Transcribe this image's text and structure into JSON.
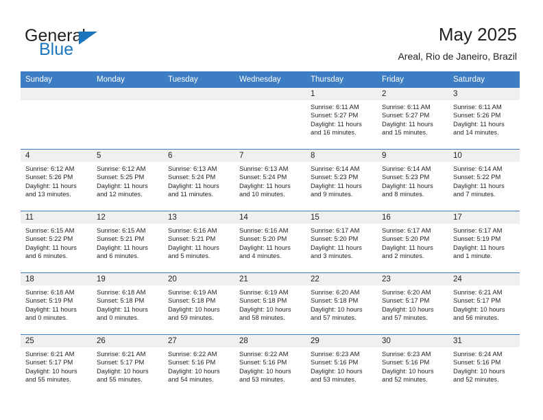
{
  "brand": {
    "name_part1": "General",
    "name_part2": "Blue",
    "triangle_color": "#1b75bc"
  },
  "header": {
    "title": "May 2025",
    "subtitle": "Areal, Rio de Janeiro, Brazil"
  },
  "theme": {
    "header_blue": "#3c7dc4",
    "daynum_gray": "#f0f0f0",
    "text": "#231f20"
  },
  "weekdays": [
    "Sunday",
    "Monday",
    "Tuesday",
    "Wednesday",
    "Thursday",
    "Friday",
    "Saturday"
  ],
  "weeks": [
    [
      {
        "day": "",
        "sunrise": "",
        "sunset": "",
        "daylight1": "",
        "daylight2": ""
      },
      {
        "day": "",
        "sunrise": "",
        "sunset": "",
        "daylight1": "",
        "daylight2": ""
      },
      {
        "day": "",
        "sunrise": "",
        "sunset": "",
        "daylight1": "",
        "daylight2": ""
      },
      {
        "day": "",
        "sunrise": "",
        "sunset": "",
        "daylight1": "",
        "daylight2": ""
      },
      {
        "day": "1",
        "sunrise": "Sunrise: 6:11 AM",
        "sunset": "Sunset: 5:27 PM",
        "daylight1": "Daylight: 11 hours",
        "daylight2": "and 16 minutes."
      },
      {
        "day": "2",
        "sunrise": "Sunrise: 6:11 AM",
        "sunset": "Sunset: 5:27 PM",
        "daylight1": "Daylight: 11 hours",
        "daylight2": "and 15 minutes."
      },
      {
        "day": "3",
        "sunrise": "Sunrise: 6:11 AM",
        "sunset": "Sunset: 5:26 PM",
        "daylight1": "Daylight: 11 hours",
        "daylight2": "and 14 minutes."
      }
    ],
    [
      {
        "day": "4",
        "sunrise": "Sunrise: 6:12 AM",
        "sunset": "Sunset: 5:26 PM",
        "daylight1": "Daylight: 11 hours",
        "daylight2": "and 13 minutes."
      },
      {
        "day": "5",
        "sunrise": "Sunrise: 6:12 AM",
        "sunset": "Sunset: 5:25 PM",
        "daylight1": "Daylight: 11 hours",
        "daylight2": "and 12 minutes."
      },
      {
        "day": "6",
        "sunrise": "Sunrise: 6:13 AM",
        "sunset": "Sunset: 5:24 PM",
        "daylight1": "Daylight: 11 hours",
        "daylight2": "and 11 minutes."
      },
      {
        "day": "7",
        "sunrise": "Sunrise: 6:13 AM",
        "sunset": "Sunset: 5:24 PM",
        "daylight1": "Daylight: 11 hours",
        "daylight2": "and 10 minutes."
      },
      {
        "day": "8",
        "sunrise": "Sunrise: 6:14 AM",
        "sunset": "Sunset: 5:23 PM",
        "daylight1": "Daylight: 11 hours",
        "daylight2": "and 9 minutes."
      },
      {
        "day": "9",
        "sunrise": "Sunrise: 6:14 AM",
        "sunset": "Sunset: 5:23 PM",
        "daylight1": "Daylight: 11 hours",
        "daylight2": "and 8 minutes."
      },
      {
        "day": "10",
        "sunrise": "Sunrise: 6:14 AM",
        "sunset": "Sunset: 5:22 PM",
        "daylight1": "Daylight: 11 hours",
        "daylight2": "and 7 minutes."
      }
    ],
    [
      {
        "day": "11",
        "sunrise": "Sunrise: 6:15 AM",
        "sunset": "Sunset: 5:22 PM",
        "daylight1": "Daylight: 11 hours",
        "daylight2": "and 6 minutes."
      },
      {
        "day": "12",
        "sunrise": "Sunrise: 6:15 AM",
        "sunset": "Sunset: 5:21 PM",
        "daylight1": "Daylight: 11 hours",
        "daylight2": "and 6 minutes."
      },
      {
        "day": "13",
        "sunrise": "Sunrise: 6:16 AM",
        "sunset": "Sunset: 5:21 PM",
        "daylight1": "Daylight: 11 hours",
        "daylight2": "and 5 minutes."
      },
      {
        "day": "14",
        "sunrise": "Sunrise: 6:16 AM",
        "sunset": "Sunset: 5:20 PM",
        "daylight1": "Daylight: 11 hours",
        "daylight2": "and 4 minutes."
      },
      {
        "day": "15",
        "sunrise": "Sunrise: 6:17 AM",
        "sunset": "Sunset: 5:20 PM",
        "daylight1": "Daylight: 11 hours",
        "daylight2": "and 3 minutes."
      },
      {
        "day": "16",
        "sunrise": "Sunrise: 6:17 AM",
        "sunset": "Sunset: 5:20 PM",
        "daylight1": "Daylight: 11 hours",
        "daylight2": "and 2 minutes."
      },
      {
        "day": "17",
        "sunrise": "Sunrise: 6:17 AM",
        "sunset": "Sunset: 5:19 PM",
        "daylight1": "Daylight: 11 hours",
        "daylight2": "and 1 minute."
      }
    ],
    [
      {
        "day": "18",
        "sunrise": "Sunrise: 6:18 AM",
        "sunset": "Sunset: 5:19 PM",
        "daylight1": "Daylight: 11 hours",
        "daylight2": "and 0 minutes."
      },
      {
        "day": "19",
        "sunrise": "Sunrise: 6:18 AM",
        "sunset": "Sunset: 5:18 PM",
        "daylight1": "Daylight: 11 hours",
        "daylight2": "and 0 minutes."
      },
      {
        "day": "20",
        "sunrise": "Sunrise: 6:19 AM",
        "sunset": "Sunset: 5:18 PM",
        "daylight1": "Daylight: 10 hours",
        "daylight2": "and 59 minutes."
      },
      {
        "day": "21",
        "sunrise": "Sunrise: 6:19 AM",
        "sunset": "Sunset: 5:18 PM",
        "daylight1": "Daylight: 10 hours",
        "daylight2": "and 58 minutes."
      },
      {
        "day": "22",
        "sunrise": "Sunrise: 6:20 AM",
        "sunset": "Sunset: 5:18 PM",
        "daylight1": "Daylight: 10 hours",
        "daylight2": "and 57 minutes."
      },
      {
        "day": "23",
        "sunrise": "Sunrise: 6:20 AM",
        "sunset": "Sunset: 5:17 PM",
        "daylight1": "Daylight: 10 hours",
        "daylight2": "and 57 minutes."
      },
      {
        "day": "24",
        "sunrise": "Sunrise: 6:21 AM",
        "sunset": "Sunset: 5:17 PM",
        "daylight1": "Daylight: 10 hours",
        "daylight2": "and 56 minutes."
      }
    ],
    [
      {
        "day": "25",
        "sunrise": "Sunrise: 6:21 AM",
        "sunset": "Sunset: 5:17 PM",
        "daylight1": "Daylight: 10 hours",
        "daylight2": "and 55 minutes."
      },
      {
        "day": "26",
        "sunrise": "Sunrise: 6:21 AM",
        "sunset": "Sunset: 5:17 PM",
        "daylight1": "Daylight: 10 hours",
        "daylight2": "and 55 minutes."
      },
      {
        "day": "27",
        "sunrise": "Sunrise: 6:22 AM",
        "sunset": "Sunset: 5:16 PM",
        "daylight1": "Daylight: 10 hours",
        "daylight2": "and 54 minutes."
      },
      {
        "day": "28",
        "sunrise": "Sunrise: 6:22 AM",
        "sunset": "Sunset: 5:16 PM",
        "daylight1": "Daylight: 10 hours",
        "daylight2": "and 53 minutes."
      },
      {
        "day": "29",
        "sunrise": "Sunrise: 6:23 AM",
        "sunset": "Sunset: 5:16 PM",
        "daylight1": "Daylight: 10 hours",
        "daylight2": "and 53 minutes."
      },
      {
        "day": "30",
        "sunrise": "Sunrise: 6:23 AM",
        "sunset": "Sunset: 5:16 PM",
        "daylight1": "Daylight: 10 hours",
        "daylight2": "and 52 minutes."
      },
      {
        "day": "31",
        "sunrise": "Sunrise: 6:24 AM",
        "sunset": "Sunset: 5:16 PM",
        "daylight1": "Daylight: 10 hours",
        "daylight2": "and 52 minutes."
      }
    ]
  ]
}
